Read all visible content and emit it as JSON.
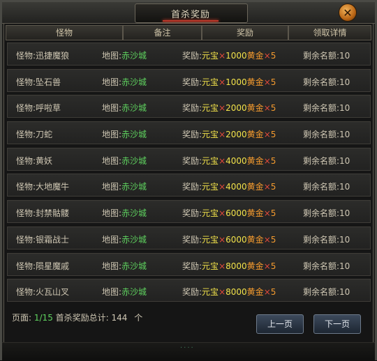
{
  "window": {
    "title": "首杀奖励",
    "close_glyph": "✕"
  },
  "columns": [
    "怪物",
    "备注",
    "奖励",
    "领取详情"
  ],
  "labels": {
    "monster": "怪物:",
    "map": "地图:",
    "reward": "奖励:",
    "remaining": "剩余名额:",
    "yuanbao": "元宝",
    "times": "×",
    "gold": "黄金"
  },
  "rows": [
    {
      "monster": "迅捷魔狼",
      "map": "赤沙城",
      "yuanbao": "1000",
      "gold": "5",
      "remaining": "10"
    },
    {
      "monster": "坠石兽",
      "map": "赤沙城",
      "yuanbao": "1000",
      "gold": "5",
      "remaining": "10"
    },
    {
      "monster": "呼啦草",
      "map": "赤沙城",
      "yuanbao": "2000",
      "gold": "5",
      "remaining": "10"
    },
    {
      "monster": "刀蛇",
      "map": "赤沙城",
      "yuanbao": "2000",
      "gold": "5",
      "remaining": "10"
    },
    {
      "monster": "黄妖",
      "map": "赤沙城",
      "yuanbao": "4000",
      "gold": "5",
      "remaining": "10"
    },
    {
      "monster": "大地魔牛",
      "map": "赤沙城",
      "yuanbao": "4000",
      "gold": "5",
      "remaining": "10"
    },
    {
      "monster": "封禁骷髅",
      "map": "赤沙城",
      "yuanbao": "6000",
      "gold": "5",
      "remaining": "10"
    },
    {
      "monster": "银霜战士",
      "map": "赤沙城",
      "yuanbao": "6000",
      "gold": "5",
      "remaining": "10"
    },
    {
      "monster": "陨星魔戚",
      "map": "赤沙城",
      "yuanbao": "8000",
      "gold": "5",
      "remaining": "10"
    },
    {
      "monster": "火瓦山叉",
      "map": "赤沙城",
      "yuanbao": "8000",
      "gold": "5",
      "remaining": "10"
    }
  ],
  "footer": {
    "page_label": "页面:",
    "page_value": "1/15",
    "total_label": "首杀奖励总计:",
    "total_value": "144",
    "total_unit": "个"
  },
  "buttons": {
    "prev": "上一页",
    "next": "下一页"
  },
  "colors": {
    "map_text": "#5fd35f",
    "yuanbao_text": "#f2e24a",
    "gold_text": "#f39a2e",
    "times_text": "#e24a3a",
    "close_button": "#d9852a"
  }
}
